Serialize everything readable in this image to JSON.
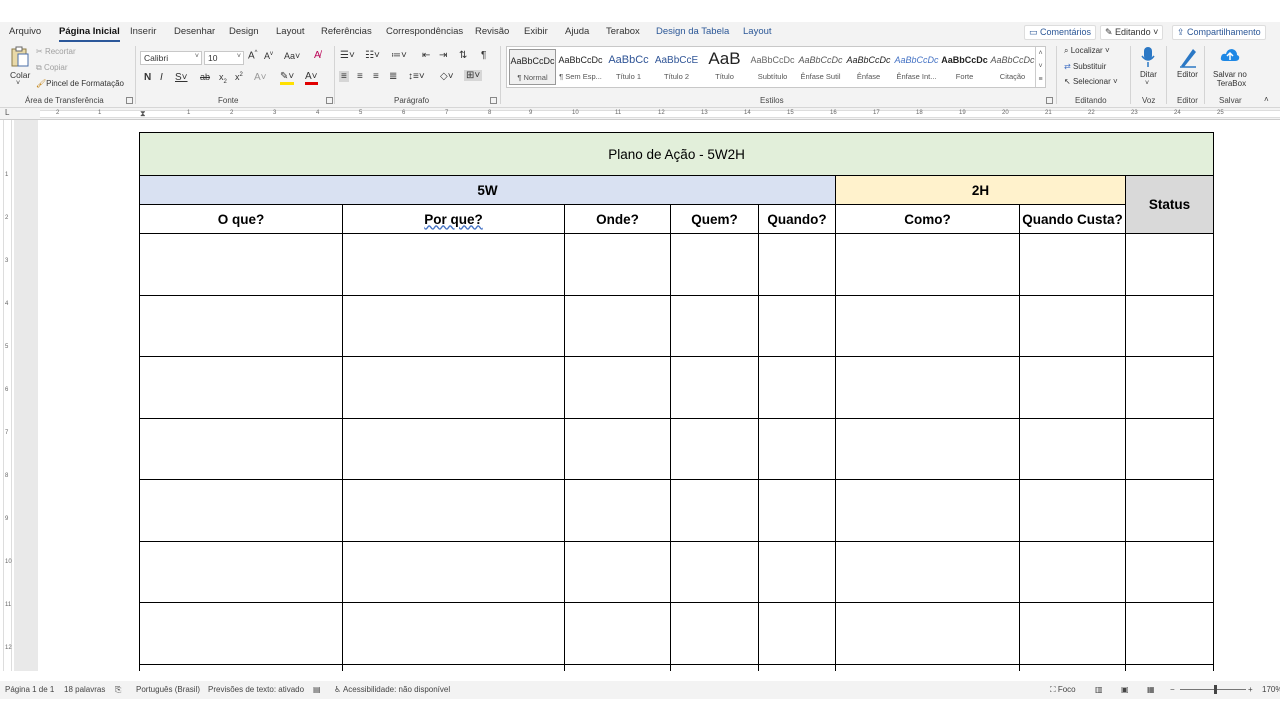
{
  "tabs": [
    {
      "label": "Arquivo"
    },
    {
      "label": "Página Inicial"
    },
    {
      "label": "Inserir"
    },
    {
      "label": "Desenhar"
    },
    {
      "label": "Design"
    },
    {
      "label": "Layout"
    },
    {
      "label": "Referências"
    },
    {
      "label": "Correspondências"
    },
    {
      "label": "Revisão"
    },
    {
      "label": "Exibir"
    },
    {
      "label": "Ajuda"
    },
    {
      "label": "Terabox"
    },
    {
      "label": "Design da Tabela"
    },
    {
      "label": "Layout"
    }
  ],
  "top_actions": {
    "comments": "Comentários",
    "editing": "Editando",
    "share": "Compartilhamento"
  },
  "clipboard": {
    "paste": "Colar",
    "cut": "Recortar",
    "copy": "Copiar",
    "format_painter": "Pincel de Formatação",
    "group": "Área de Transferência"
  },
  "font": {
    "name": "Calibri",
    "size": "10",
    "group": "Fonte"
  },
  "paragraph": {
    "group": "Parágrafo"
  },
  "styles": {
    "group": "Estilos",
    "items": [
      {
        "preview": "AaBbCcDc",
        "name": "¶ Normal"
      },
      {
        "preview": "AaBbCcDc",
        "name": "¶ Sem Esp..."
      },
      {
        "preview": "AaBbCc",
        "name": "Título 1"
      },
      {
        "preview": "AaBbCcE",
        "name": "Título 2"
      },
      {
        "preview": "AaB",
        "name": "Título"
      },
      {
        "preview": "AaBbCcDc",
        "name": "Subtítulo"
      },
      {
        "preview": "AaBbCcDc",
        "name": "Ênfase Sutil"
      },
      {
        "preview": "AaBbCcDc",
        "name": "Ênfase"
      },
      {
        "preview": "AaBbCcDc",
        "name": "Ênfase Int..."
      },
      {
        "preview": "AaBbCcDc",
        "name": "Forte"
      },
      {
        "preview": "AaBbCcDc",
        "name": "Citação"
      }
    ]
  },
  "editing": {
    "find": "Localizar",
    "replace": "Substituir",
    "select": "Selecionar",
    "group": "Editando"
  },
  "voice": {
    "dictate": "Ditar",
    "group": "Voz"
  },
  "editor": {
    "label": "Editor",
    "group": "Editor"
  },
  "save": {
    "line1": "Salvar no",
    "line2": "TeraBox",
    "group": "Salvar"
  },
  "ruler": {
    "numbers": [
      "2",
      "1",
      "1",
      "2",
      "3",
      "4",
      "5",
      "6",
      "7",
      "8",
      "9",
      "10",
      "11",
      "12",
      "13",
      "14",
      "15",
      "16",
      "17",
      "18",
      "19",
      "20",
      "21",
      "22",
      "23",
      "24",
      "25"
    ],
    "vnumbers": [
      "1",
      "2",
      "3",
      "4",
      "5",
      "6",
      "7",
      "8",
      "9",
      "10",
      "11",
      "12"
    ]
  },
  "table": {
    "title": "Plano de Ação - 5W2H",
    "group_5w": "5W",
    "group_2h": "2H",
    "status": "Status",
    "headers": [
      "O que?",
      "Por que?",
      "Onde?",
      "Quem?",
      "Quando?",
      "Como?",
      "Quando Custa?"
    ]
  },
  "statusbar": {
    "page": "Página 1 de 1",
    "words": "18 palavras",
    "language": "Português (Brasil)",
    "predictions": "Previsões de texto: ativado",
    "accessibility": "Acessibilidade: não disponível",
    "focus": "Foco",
    "zoom": "170%"
  }
}
